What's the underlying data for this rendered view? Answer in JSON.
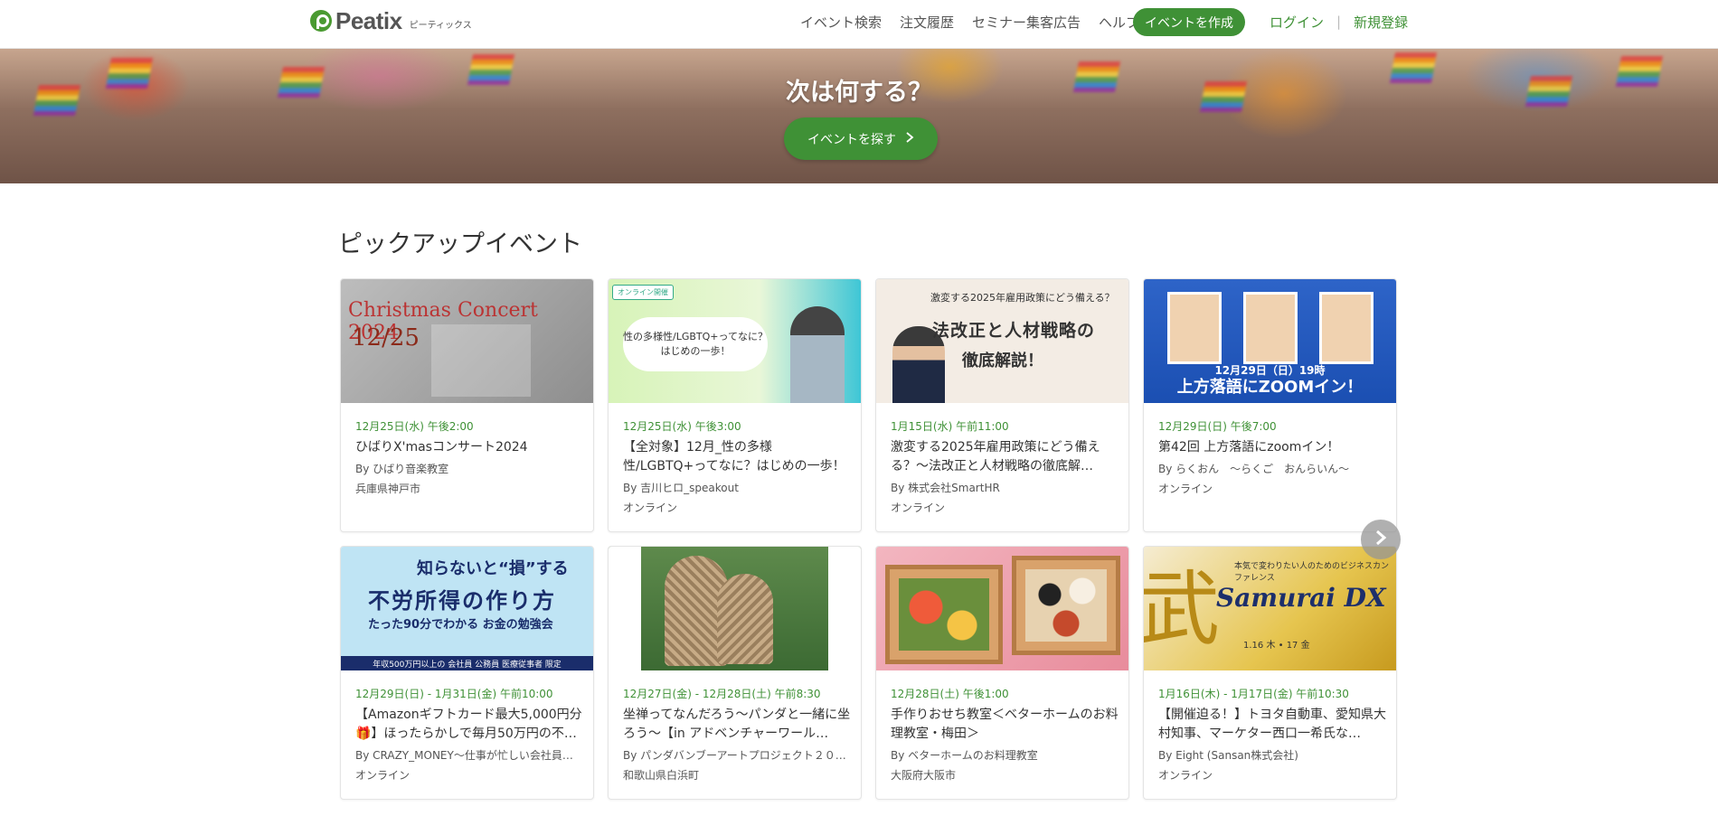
{
  "header": {
    "logo_text": "Peatix",
    "logo_sub": "ピーティックス",
    "nav": [
      "イベント検索",
      "注文履歴",
      "セミナー集客広告",
      "ヘルプ"
    ],
    "create_label": "イベントを作成",
    "login_label": "ログイン",
    "separator": "|",
    "signup_label": "新規登録"
  },
  "hero": {
    "title": "次は何する？",
    "button_label": "イベントを探す",
    "button_icon": "chevron-right-icon"
  },
  "section": {
    "title": "ピックアップイベント"
  },
  "thumbs": {
    "t1": {
      "big": "Christmas Concert 2024",
      "date": "12/25"
    },
    "t2": {
      "badge": "オンライン開催",
      "pill": "性の多様性/LGBTQ+ってなに？はじめの一歩！"
    },
    "t3": {
      "head": "激変する2025年雇用政策にどう備える？",
      "line1": "法改正と人材戦略の",
      "line2": "徹底解説！"
    },
    "t4": {
      "caption_small": "12月29日（日）19時",
      "caption": "上方落語にZOOMイン！"
    },
    "t5": {
      "line1": "知らないと“損”する",
      "line2": "不労所得の作り方",
      "line3": "たった90分でわかる お金の勉強会",
      "bar": "年収500万円以上の 会社員 公務員 医療従事者 限定"
    },
    "t8": {
      "brush": "武",
      "title": "Samurai DX",
      "sub": "本気で変わりたい人のためのビジネスカンファレンス",
      "dates": "1.16 木 • 17 金"
    }
  },
  "events": [
    {
      "date": "12月25日(水) 午後2:00",
      "title": "ひばりX'masコンサート2024",
      "by": "By ひばり音楽教室",
      "location": "兵庫県神戸市"
    },
    {
      "date": "12月25日(水) 午後3:00",
      "title": "【全対象】12月_性の多様性/LGBTQ+ってなに？はじめの一歩！",
      "by": "By 吉川ヒロ_speakout",
      "location": "オンライン"
    },
    {
      "date": "1月15日(水) 午前11:00",
      "title": "激変する2025年雇用政策にどう備える？〜法改正と人材戦略の徹底解…",
      "by": "By 株式会社SmartHR",
      "location": "オンライン"
    },
    {
      "date": "12月29日(日) 午後7:00",
      "title": "第42回 上方落語にzoomイン！",
      "by": "By らくおん　〜らくご　おんらいん〜",
      "location": "オンライン"
    },
    {
      "date": "12月29日(日) - 1月31日(金) 午前10:00",
      "title": "【Amazonギフトカード最大5,000円分🎁】ほったらかしで毎月50万円の不…",
      "by": "By CRAZY_MONEY〜仕事が忙しい会社員…",
      "location": "オンライン"
    },
    {
      "date": "12月27日(金) - 12月28日(土) 午前8:30",
      "title": "坐禅ってなんだろう〜パンダと一緒に坐ろう〜【in アドベンチャーワール…",
      "by": "By パンダバンブーアートプロジェクト２０…",
      "location": "和歌山県白浜町"
    },
    {
      "date": "12月28日(土) 午後1:00",
      "title": "手作りおせち教室＜ベターホームのお料理教室・梅田＞",
      "by": "By ベターホームのお料理教室",
      "location": "大阪府大阪市"
    },
    {
      "date": "1月16日(木) - 1月17日(金) 午前10:30",
      "title": "【開催迫る！】トヨタ自動車、愛知県大村知事、マーケター西口一希氏な…",
      "by": "By Eight (Sansan株式会社)",
      "location": "オンライン"
    }
  ],
  "carousel": {
    "next_icon": "chevron-right-icon"
  },
  "colors": {
    "accent": "#3f9136",
    "date": "#3f9136"
  }
}
